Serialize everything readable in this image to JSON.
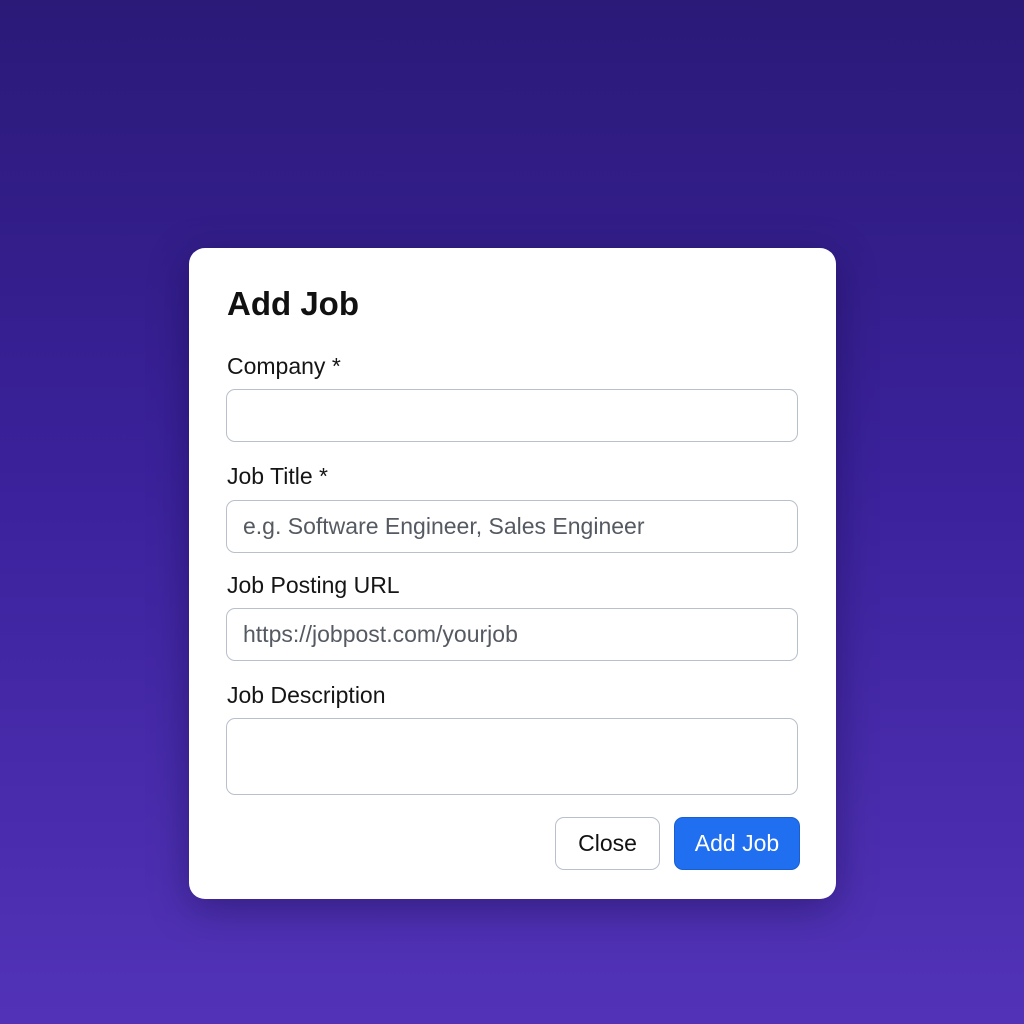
{
  "modal": {
    "title": "Add Job",
    "fields": {
      "company": {
        "label": "Company *",
        "value": "",
        "placeholder": ""
      },
      "job_title": {
        "label": "Job Title *",
        "value": "",
        "placeholder": "e.g. Software Engineer, Sales Engineer"
      },
      "job_url": {
        "label": "Job Posting URL",
        "value": "",
        "placeholder": "https://jobpost.com/yourjob"
      },
      "job_description": {
        "label": "Job Description",
        "value": "",
        "placeholder": ""
      }
    },
    "buttons": {
      "close_label": "Close",
      "submit_label": "Add Job"
    }
  },
  "colors": {
    "background_top": "#2b1a78",
    "background_bottom": "#5233b8",
    "primary_button": "#1f6ff0",
    "input_border": "#b8c0cc"
  }
}
